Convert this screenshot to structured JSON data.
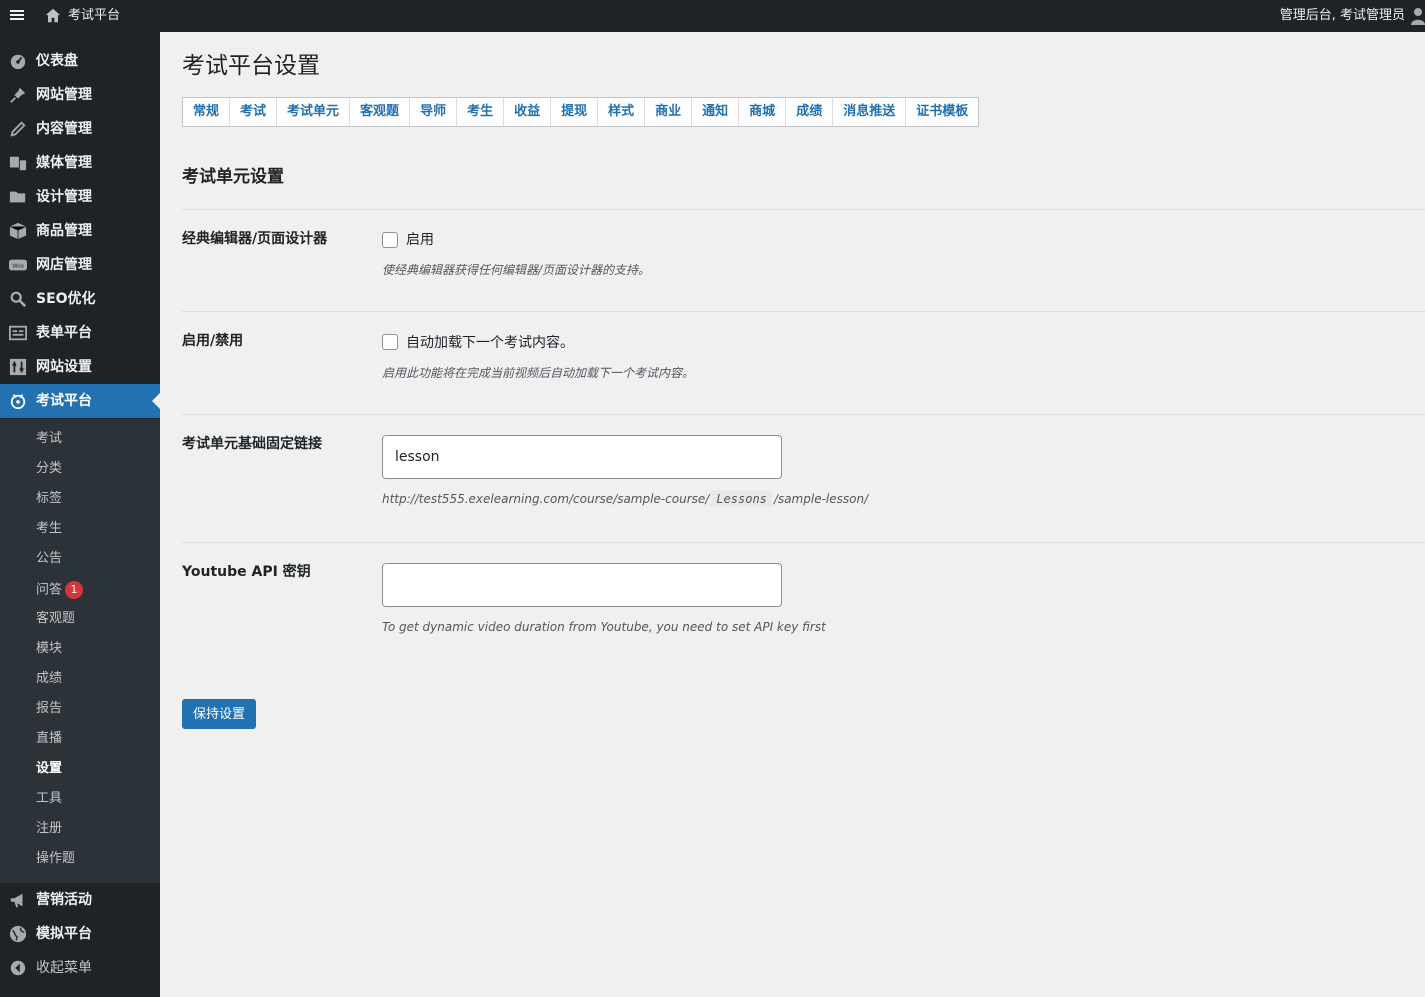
{
  "adminbar": {
    "site_title": "考试平台",
    "account": "管理后台, 考试管理员"
  },
  "sidebar": {
    "items": [
      {
        "label": "仪表盘",
        "icon": "dashboard-icon"
      },
      {
        "label": "网站管理",
        "icon": "pin-icon"
      },
      {
        "label": "内容管理",
        "icon": "edit-icon"
      },
      {
        "label": "媒体管理",
        "icon": "media-icon"
      },
      {
        "label": "设计管理",
        "icon": "folder-icon"
      },
      {
        "label": "商品管理",
        "icon": "box-icon"
      },
      {
        "label": "网店管理",
        "icon": "woo-icon"
      },
      {
        "label": "SEO优化",
        "icon": "search-icon"
      },
      {
        "label": "表单平台",
        "icon": "form-icon"
      },
      {
        "label": "网站设置",
        "icon": "settings-icon"
      },
      {
        "label": "考试平台",
        "icon": "exam-icon"
      }
    ],
    "submenu": [
      "考试",
      "分类",
      "标签",
      "考生",
      "公告",
      "问答",
      "客观题",
      "模块",
      "成绩",
      "报告",
      "直播",
      "设置",
      "工具",
      "注册",
      "操作题"
    ],
    "qa_badge": "1",
    "bottom_items": [
      {
        "label": "营销活动",
        "icon": "megaphone-icon"
      },
      {
        "label": "模拟平台",
        "icon": "globe-icon"
      }
    ],
    "collapse_label": "收起菜单"
  },
  "main": {
    "page_title": "考试平台设置",
    "tabs": [
      "常规",
      "考试",
      "考试单元",
      "客观题",
      "导师",
      "考生",
      "收益",
      "提现",
      "样式",
      "商业",
      "通知",
      "商城",
      "成绩",
      "消息推送",
      "证书模板"
    ],
    "section_title": "考试单元设置",
    "fields": {
      "classic_editor": {
        "label": "经典编辑器/页面设计器",
        "checkbox_label": "启用",
        "description": "使经典编辑器获得任何编辑器/页面设计器的支持。"
      },
      "autoload": {
        "label": "启用/禁用",
        "checkbox_label": "自动加载下一个考试内容。",
        "description": "启用此功能将在完成当前视频后自动加载下一个考试内容。"
      },
      "permalink": {
        "label": "考试单元基础固定链接",
        "value": "lesson",
        "url_prefix": "http://test555.exelearning.com/course/sample-course/",
        "url_code": "Lessons",
        "url_suffix": "/sample-lesson/"
      },
      "youtube": {
        "label": "Youtube API 密钥",
        "value": "",
        "description": "To get dynamic video duration from Youtube, you need to set API key first"
      }
    },
    "save_label": "保持设置"
  }
}
